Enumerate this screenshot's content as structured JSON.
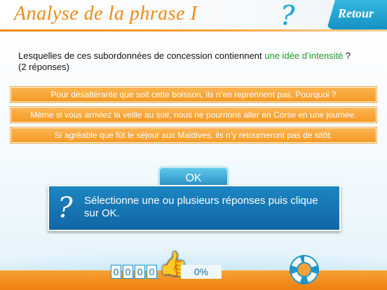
{
  "header": {
    "title": "Analyse de la phrase I",
    "help_glyph": "?",
    "back_label": "Retour"
  },
  "question": {
    "prefix": "Lesquelles de ces subordonnées de concession contiennent ",
    "highlight": "une idée d’intensité",
    "suffix": " ?",
    "note": "(2 réponses)",
    "highlight_color": "#1e9a2a"
  },
  "answers": [
    "Pour désaltérante que soit cette boisson, ils n’en reprennent pas. Pourquoi ?",
    "Même si vous arriviez la veille au soir, nous ne pourrions aller en Corse en une journée.",
    "Si agréable que fût le séjour aux Maldives, ils n’y retourneront pas de sitôt."
  ],
  "ok_label": "OK",
  "instruction": {
    "icon": "?",
    "text": "Sélectionne une ou plusieurs réponses puis clique sur OK."
  },
  "footer": {
    "score_digits": [
      "0",
      "0",
      "0",
      "0"
    ],
    "progress_text": "0%",
    "progress_value": 0
  },
  "colors": {
    "accent_orange": "#f08a14",
    "accent_blue": "#1591c4"
  }
}
